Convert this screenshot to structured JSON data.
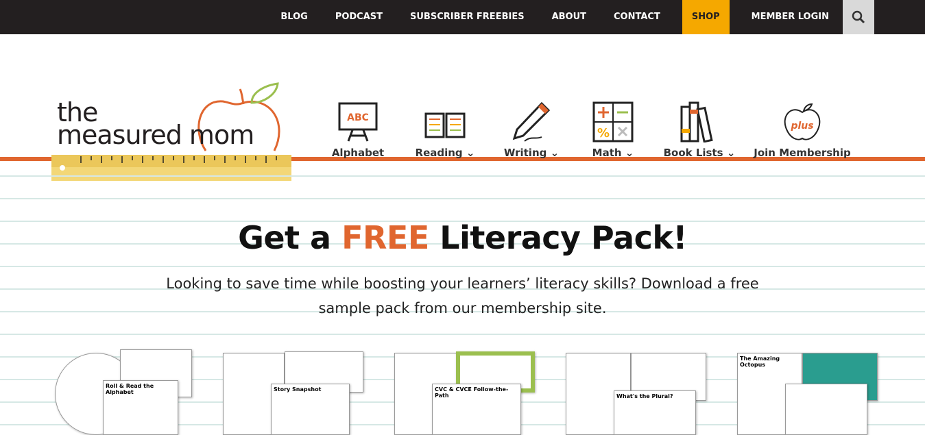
{
  "topnav": {
    "items": [
      "BLOG",
      "PODCAST",
      "SUBSCRIBER FREEBIES",
      "ABOUT",
      "CONTACT",
      "SHOP",
      "MEMBER LOGIN"
    ],
    "shop_color": "#f5a800"
  },
  "logo": {
    "line1": "the",
    "line2": "measured mom"
  },
  "mainnav": [
    {
      "label": "Alphabet",
      "icon": "chalkboard-abc-icon",
      "dropdown": false
    },
    {
      "label": "Reading",
      "icon": "open-book-icon",
      "dropdown": true
    },
    {
      "label": "Writing",
      "icon": "pencil-icon",
      "dropdown": true
    },
    {
      "label": "Math",
      "icon": "math-symbols-icon",
      "dropdown": true
    },
    {
      "label": "Book Lists",
      "icon": "books-icon",
      "dropdown": true
    },
    {
      "label": "Join Membership",
      "icon": "apple-plus-icon",
      "dropdown": false
    }
  ],
  "hero": {
    "title_pre": "Get a ",
    "title_accent": "FREE",
    "title_post": " Literacy Pack!",
    "accent_color": "#e0662f",
    "text": "Looking to save time while boosting your learners’ literacy skills? Download a free sample pack from our membership site."
  },
  "products": [
    {
      "caption": "Roll & Read the Alphabet"
    },
    {
      "caption": "Story Snapshot"
    },
    {
      "caption": "CVC & CVCE Follow-the-Path"
    },
    {
      "caption": "What's the Plural?"
    },
    {
      "caption": "The Amazing Octopus"
    }
  ]
}
